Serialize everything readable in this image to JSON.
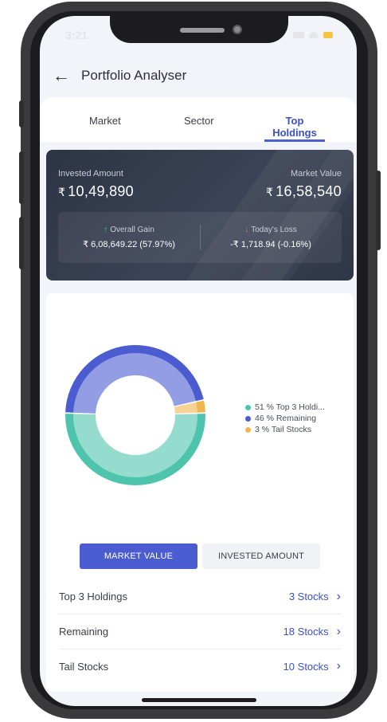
{
  "status": {
    "time": "3:21"
  },
  "header": {
    "back_icon": "arrow-left-icon",
    "title": "Portfolio Analyser"
  },
  "tabs": [
    {
      "label": "Market",
      "active": false
    },
    {
      "label": "Sector",
      "active": false
    },
    {
      "label": "Top Holdings",
      "active": true
    }
  ],
  "summary": {
    "invested_label": "Invested Amount",
    "invested_currency": "₹",
    "invested_value": "10,49,890",
    "market_label": "Market Value",
    "market_currency": "₹",
    "market_value": "16,58,540",
    "gain_label": "Overall Gain",
    "gain_value": "₹ 6,08,649.22 (57.97%)",
    "loss_label": "Today's Loss",
    "loss_value": "-₹ 1,718.94 (-0.16%)"
  },
  "chart_data": {
    "type": "pie",
    "series": [
      {
        "name": "Top 3 Holdi...",
        "value": 51,
        "color": "#4fc4ad"
      },
      {
        "name": "Remaining",
        "value": 46,
        "color": "#4a5cd0"
      },
      {
        "name": "Tail Stocks",
        "value": 3,
        "color": "#f0b64e"
      }
    ],
    "legend": [
      "51 % Top 3 Holdi...",
      "46 % Remaining",
      "3 % Tail Stocks"
    ],
    "legend_position": "right"
  },
  "toggle": {
    "market_value": "MARKET VALUE",
    "invested_amount": "INVESTED AMOUNT"
  },
  "holdings": [
    {
      "name": "Top 3 Holdings",
      "count": "3 Stocks"
    },
    {
      "name": "Remaining",
      "count": "18 Stocks"
    },
    {
      "name": "Tail Stocks",
      "count": "10 Stocks"
    }
  ],
  "colors": {
    "accent": "#4a5cd0",
    "gain": "#4cc59a",
    "loss": "#e86a6a"
  }
}
